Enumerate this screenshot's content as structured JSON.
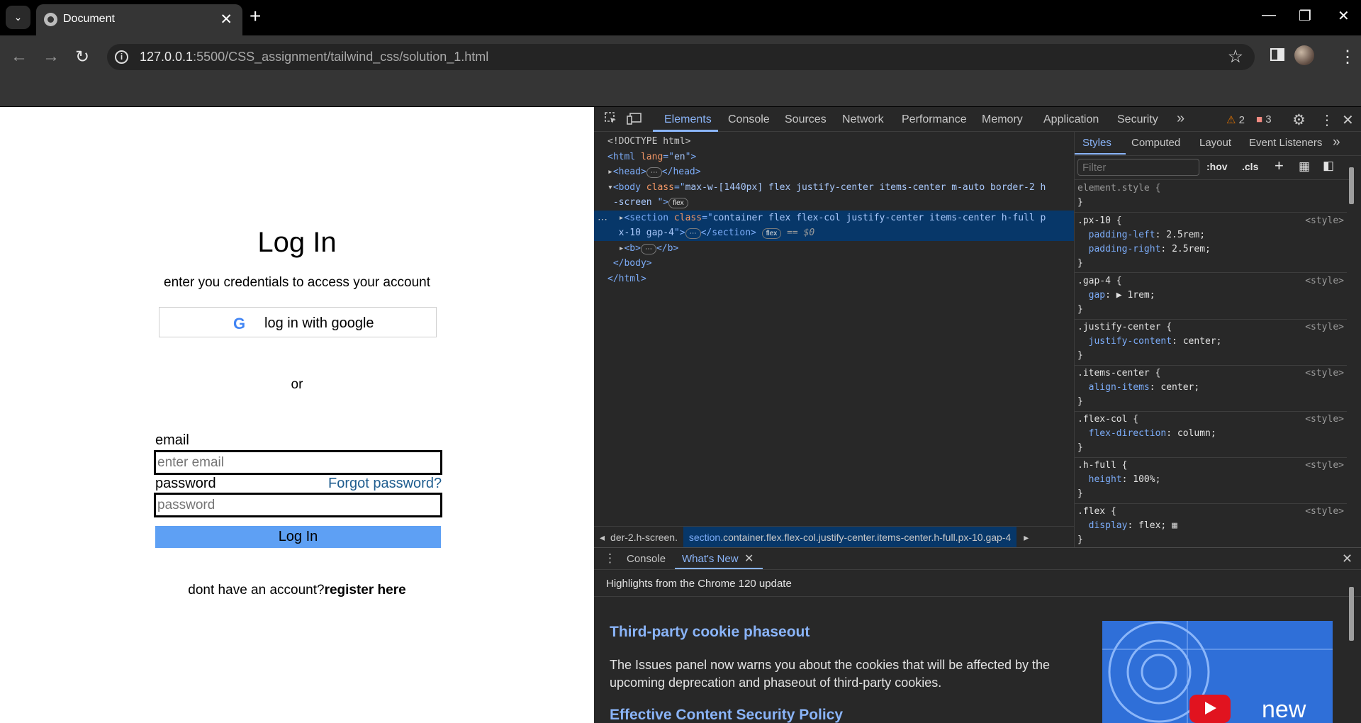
{
  "browser": {
    "tab_title": "Document",
    "new_tab": "+",
    "tab_close": "✕",
    "url_host": "127.0.0.1",
    "url_path": ":5500/CSS_assignment/tailwind_css/solution_1.html",
    "win_min": "—",
    "win_restore": "❐",
    "win_close": "✕"
  },
  "page": {
    "title": "Log In",
    "subtitle": "enter you credentials to access your account",
    "google_button": "log in with google",
    "google_g": "G",
    "or": "or",
    "email_label": "email",
    "email_placeholder": "enter email",
    "password_label": "password",
    "password_placeholder": "password",
    "forgot": "Forgot password?",
    "login_button": "Log In",
    "register_prefix": "dont have an account?",
    "register_link": "register here"
  },
  "devtools": {
    "tabs": [
      "Elements",
      "Console",
      "Sources",
      "Network",
      "Performance",
      "Memory",
      "Application",
      "Security"
    ],
    "more_tabs": "»",
    "warnings": "2",
    "errors": "3",
    "dom": {
      "doctype": "<!DOCTYPE html>",
      "html_open_tag": "<html",
      "html_attr": " lang",
      "html_eq": "=\"",
      "html_val": "en",
      "html_close": "\">",
      "head": "<head>",
      "head_end": "</head>",
      "body_tag": "<body",
      "body_attr": " class",
      "body_val": "max-w-[1440px] flex justify-center items-center m-auto border-2 h",
      "body_val2": "-screen ",
      "body_close": "\">",
      "flex_pill": "flex",
      "section_tag": "<section",
      "section_attr": " class",
      "section_val": "container flex flex-col justify-center items-center h-full p",
      "section_val2": "x-10 gap-4",
      "section_end": "</section>",
      "dollar0": "== $0",
      "b_open": "<b>",
      "b_close": "</b>",
      "body_end": "</body>",
      "html_end": "</html>"
    },
    "breadcrumb_prev": "der-2.h-screen.",
    "breadcrumb_tag": "section",
    "breadcrumb_classes": ".container.flex.flex-col.justify-center.items-center.h-full.px-10.gap-4",
    "styles_tabs": [
      "Styles",
      "Computed",
      "Layout",
      "Event Listeners"
    ],
    "filter_placeholder": "Filter",
    "hov": ":hov",
    "cls": ".cls",
    "rules": [
      {
        "selector": "element.style {",
        "props": [],
        "source": ""
      },
      {
        "selector": ".px-10 {",
        "props": [
          [
            "padding-left",
            "2.5rem;"
          ],
          [
            "padding-right",
            "2.5rem;"
          ]
        ],
        "source": "<style>"
      },
      {
        "selector": ".gap-4 {",
        "props": [
          [
            "gap",
            "▶ 1rem;"
          ]
        ],
        "source": "<style>"
      },
      {
        "selector": ".justify-center {",
        "props": [
          [
            "justify-content",
            "center;"
          ]
        ],
        "source": "<style>"
      },
      {
        "selector": ".items-center {",
        "props": [
          [
            "align-items",
            "center;"
          ]
        ],
        "source": "<style>"
      },
      {
        "selector": ".flex-col {",
        "props": [
          [
            "flex-direction",
            "column;"
          ]
        ],
        "source": "<style>"
      },
      {
        "selector": ".h-full {",
        "props": [
          [
            "height",
            "100%;"
          ]
        ],
        "source": "<style>"
      },
      {
        "selector": ".flex {",
        "props": [
          [
            "display",
            "flex;"
          ]
        ],
        "source": "<style>"
      }
    ],
    "drawer_tabs": [
      "Console",
      "What's New"
    ],
    "whats_new": {
      "header": "Highlights from the Chrome 120 update",
      "h1": "Third-party cookie phaseout",
      "p1": "The Issues panel now warns you about the cookies that will be affected by the upcoming deprecation and phaseout of third-party cookies.",
      "h2": "Effective Content Security Policy",
      "img_text": "new"
    }
  }
}
